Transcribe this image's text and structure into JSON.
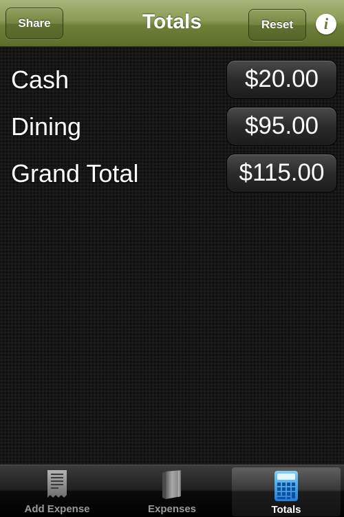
{
  "navbar": {
    "title": "Totals",
    "share_label": "Share",
    "reset_label": "Reset",
    "info_icon": "info-icon",
    "info_glyph": "i"
  },
  "totals": [
    {
      "label": "Cash",
      "amount": "$20.00"
    },
    {
      "label": "Dining",
      "amount": "$95.00"
    },
    {
      "label": "Grand Total",
      "amount": "$115.00"
    }
  ],
  "tabbar": {
    "selected": "Totals",
    "tabs": [
      {
        "label": "Add Expense",
        "icon": "receipt-icon"
      },
      {
        "label": "Expenses",
        "icon": "book-icon"
      },
      {
        "label": "Totals",
        "icon": "calculator-icon"
      }
    ]
  },
  "colors": {
    "nav_green": "#7d8d46",
    "selected_icon_blue": "#3aa0e8"
  }
}
